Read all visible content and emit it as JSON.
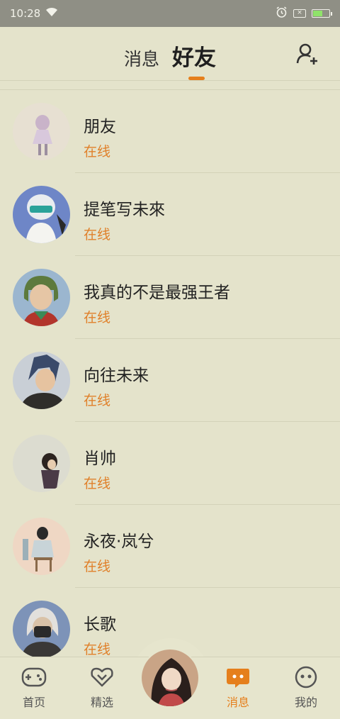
{
  "status_bar": {
    "time": "10:28",
    "sim": "×",
    "battery_level": 0.6
  },
  "header": {
    "tabs": [
      {
        "label": "消息"
      },
      {
        "label": "好友"
      }
    ],
    "active_tab": "好友"
  },
  "friends": [
    {
      "name": "朋友",
      "status": "在线"
    },
    {
      "name": "提笔写未來",
      "status": "在线"
    },
    {
      "name": "我真的不是最强王者",
      "status": "在线"
    },
    {
      "name": "向往未来",
      "status": "在线"
    },
    {
      "name": "肖帅",
      "status": "在线"
    },
    {
      "name": "永夜·岚兮",
      "status": "在线"
    },
    {
      "name": "长歌",
      "status": "在线"
    }
  ],
  "bottom_nav": {
    "items": [
      {
        "label": "首页",
        "icon": "gamepad-icon"
      },
      {
        "label": "精选",
        "icon": "heart-chevron-icon"
      },
      {
        "label": "",
        "icon": "user-avatar"
      },
      {
        "label": "消息",
        "icon": "chat-bubble-icon"
      },
      {
        "label": "我的",
        "icon": "face-icon"
      }
    ],
    "active": "消息"
  },
  "colors": {
    "accent": "#e57f1c",
    "background": "#e4e3cb",
    "status_bar": "#8f8f85",
    "online": "#e0802a"
  }
}
